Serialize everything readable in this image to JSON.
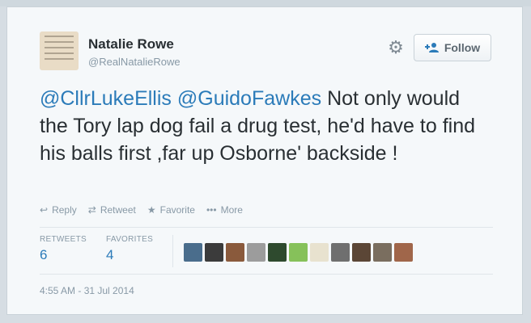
{
  "author": {
    "name": "Natalie Rowe",
    "handle": "@RealNatalieRowe"
  },
  "follow_label": "Follow",
  "tweet": {
    "mention1": "@CllrLukeEllis",
    "mention2": "@GuidoFawkes",
    "text": "Not only would the Tory lap dog fail a drug test, he'd have to find his balls first ,far up Osborne' backside !"
  },
  "actions": {
    "reply": "Reply",
    "retweet": "Retweet",
    "favorite": "Favorite",
    "more": "More"
  },
  "stats": {
    "retweets_label": "RETWEETS",
    "retweets_value": "6",
    "favorites_label": "FAVORITES",
    "favorites_value": "4"
  },
  "timestamp": "4:55 AM - 31 Jul 2014",
  "favoriter_colors": [
    "#4a6d8c",
    "#3b3b3b",
    "#8a5a3c",
    "#9c9c9c",
    "#2e4a2e",
    "#86c15a",
    "#e8e2cf",
    "#6f6f6f",
    "#5b4636",
    "#7a6e5f",
    "#a0664a"
  ],
  "icons": {
    "gear": "gear-icon",
    "follow": "add-user-icon",
    "reply": "reply-icon",
    "retweet": "retweet-icon",
    "favorite": "star-icon",
    "more": "more-icon"
  }
}
